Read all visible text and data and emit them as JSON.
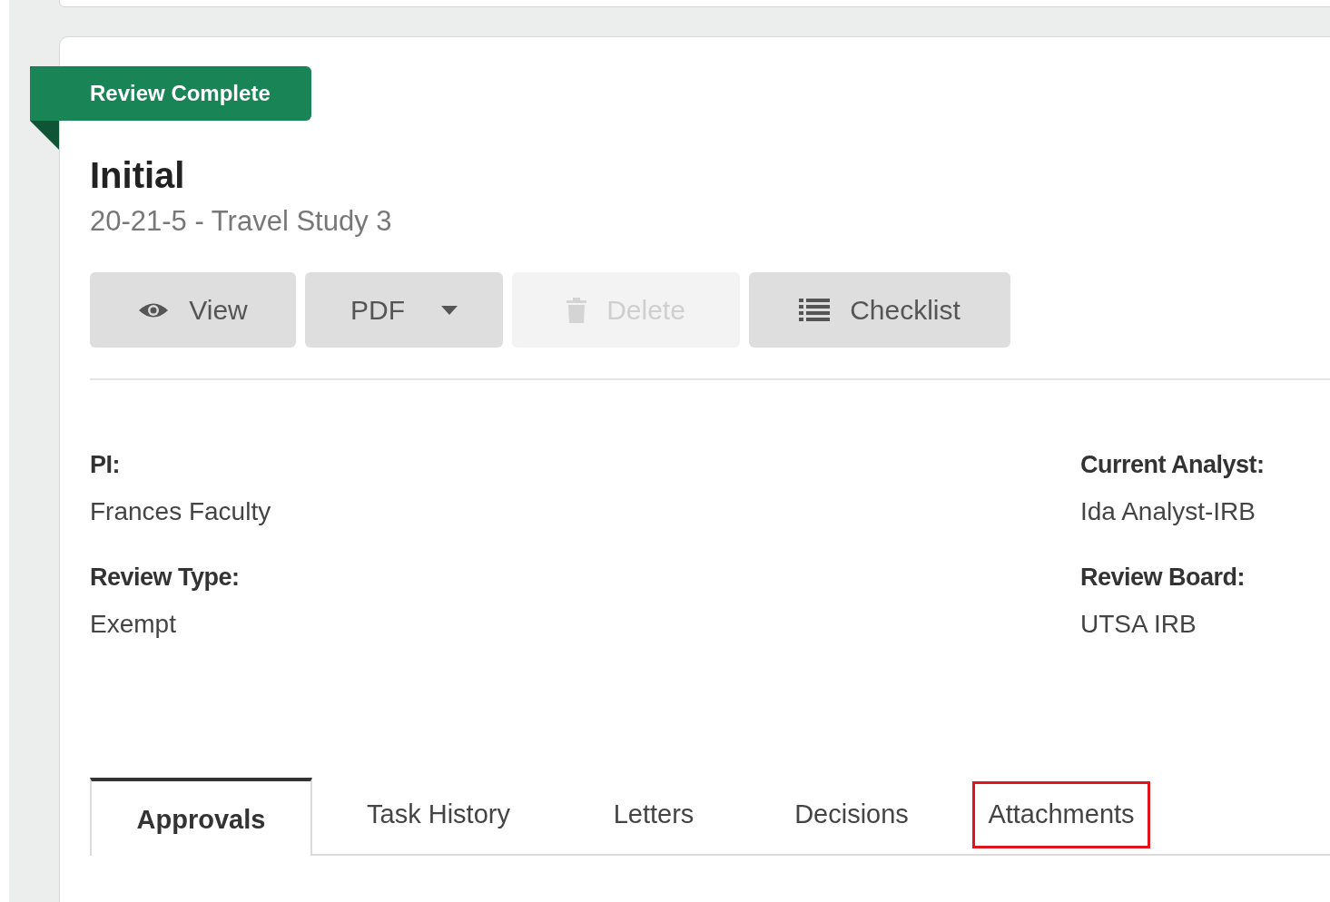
{
  "status_ribbon": {
    "label": "Review Complete"
  },
  "header": {
    "title": "Initial",
    "subtitle": "20-21-5 - Travel Study 3"
  },
  "buttons": [
    {
      "kind": "eye",
      "label": "View",
      "disabled": false
    },
    {
      "kind": "dropdown",
      "label": "PDF",
      "disabled": false
    },
    {
      "kind": "trash",
      "label": "Delete",
      "disabled": true
    },
    {
      "kind": "list",
      "label": "Checklist",
      "disabled": false
    }
  ],
  "details": {
    "left": [
      {
        "label": "PI:",
        "value": "Frances Faculty"
      },
      {
        "label": "Review Type:",
        "value": "Exempt"
      }
    ],
    "right": [
      {
        "label": "Current Analyst:",
        "value": "Ida Analyst-IRB"
      },
      {
        "label": "Review Board:",
        "value": "UTSA IRB"
      }
    ]
  },
  "tabs": [
    {
      "label": "Approvals",
      "selected": true,
      "highlighted": false
    },
    {
      "label": "Task History",
      "selected": false,
      "highlighted": false
    },
    {
      "label": "Letters",
      "selected": false,
      "highlighted": false
    },
    {
      "label": "Decisions",
      "selected": false,
      "highlighted": false
    },
    {
      "label": "Attachments",
      "selected": false,
      "highlighted": true
    }
  ]
}
